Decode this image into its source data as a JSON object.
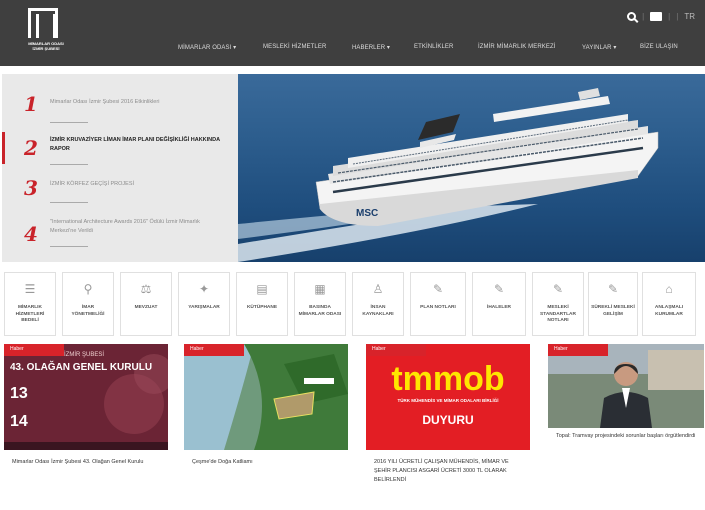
{
  "header": {
    "logo_lines": [
      "MİMARLAR ODASI",
      "İZMİR ŞUBESİ"
    ],
    "lang": "TR",
    "nav": [
      {
        "label": "MİMARLAR ODASI ▾"
      },
      {
        "label": "MESLEKİ HİZMETLER"
      },
      {
        "label": "HABERLER ▾"
      },
      {
        "label": "ETKİNLİKLER"
      },
      {
        "label": "İZMİR MİMARLIK MERKEZİ"
      },
      {
        "label": "YAYINLAR ▾"
      },
      {
        "label": "BİZE ULAŞIN"
      }
    ]
  },
  "slider": {
    "items": [
      {
        "num": "1",
        "text": "Mimarlar Odası İzmir Şubesi 2016 Etkinlikleri"
      },
      {
        "num": "2",
        "text": "İZMİR KRUVAZİYER LİMAN İMAR PLANI DEĞİŞİKLİĞİ HAKKINDA RAPOR"
      },
      {
        "num": "3",
        "text": "İZMİR KÖRFEZ GEÇİŞİ PROJESİ"
      },
      {
        "num": "4",
        "text": "\"International Architecture Awards 2016\" Ödülü İzmir Mimarlık Merkezi'ne Verildi"
      }
    ],
    "ship_text": "MSC"
  },
  "categories": [
    {
      "label": "MİMARLIK HİZMETLERİ BEDELİ",
      "icon": "☰"
    },
    {
      "label": "İMAR YÖNETMELİĞİ",
      "icon": "⚲"
    },
    {
      "label": "MEVZUAT",
      "icon": "⚖"
    },
    {
      "label": "YARIŞMALAR",
      "icon": "✦"
    },
    {
      "label": "KÜTÜPHANE",
      "icon": "▤"
    },
    {
      "label": "BASINDA MİMARLAR ODASI",
      "icon": "▦"
    },
    {
      "label": "İNSAN KAYNAKLARI",
      "icon": "♙"
    },
    {
      "label": "PLAN NOTLARI",
      "icon": "✎"
    },
    {
      "label": "İHALELER",
      "icon": "✎"
    },
    {
      "label": "MESLEKİ STANDARTLAR NOTLARI",
      "icon": "✎"
    },
    {
      "label": "SÜREKLİ MESLEKİ GELİŞİM",
      "icon": "✎"
    },
    {
      "label": "ANLAŞMALI KURUMLAR",
      "icon": "⌂"
    }
  ],
  "news": [
    {
      "badge": "Haber",
      "title": "Mimarlar Odası İzmir Şubesi 43. Olağan Genel Kurulu",
      "poster": {
        "head": "İZMİR ŞUBESİ",
        "title": "43. OLAĞAN GENEL KURULU",
        "d1": "13",
        "d2": "14"
      }
    },
    {
      "badge": "Haber",
      "title": "Çeşme'de Doğa Katliamı"
    },
    {
      "badge": "Haber",
      "title": "2016 YILI ÜCRETLİ ÇALIŞAN MÜHENDİS, MİMAR VE ŞEHİR PLANCISI ASGARİ ÜCRETİ 3000 TL OLARAK BELİRLENDİ",
      "poster": {
        "brand": "tmmob",
        "sub": "TÜRK MÜHENDİS VE MİMAR ODALARI BİRLİĞİ",
        "word": "DUYURU"
      }
    },
    {
      "badge": "Haber",
      "title": "Topal: Tramvay projesindeki sorunlar başları örgütlendirdi"
    }
  ],
  "colors": {
    "header": "#3f3f3f",
    "accent": "#c9232a",
    "badge": "#d8232a",
    "poster_red": "#e31e24",
    "tmmob_yellow": "#ffe600"
  }
}
